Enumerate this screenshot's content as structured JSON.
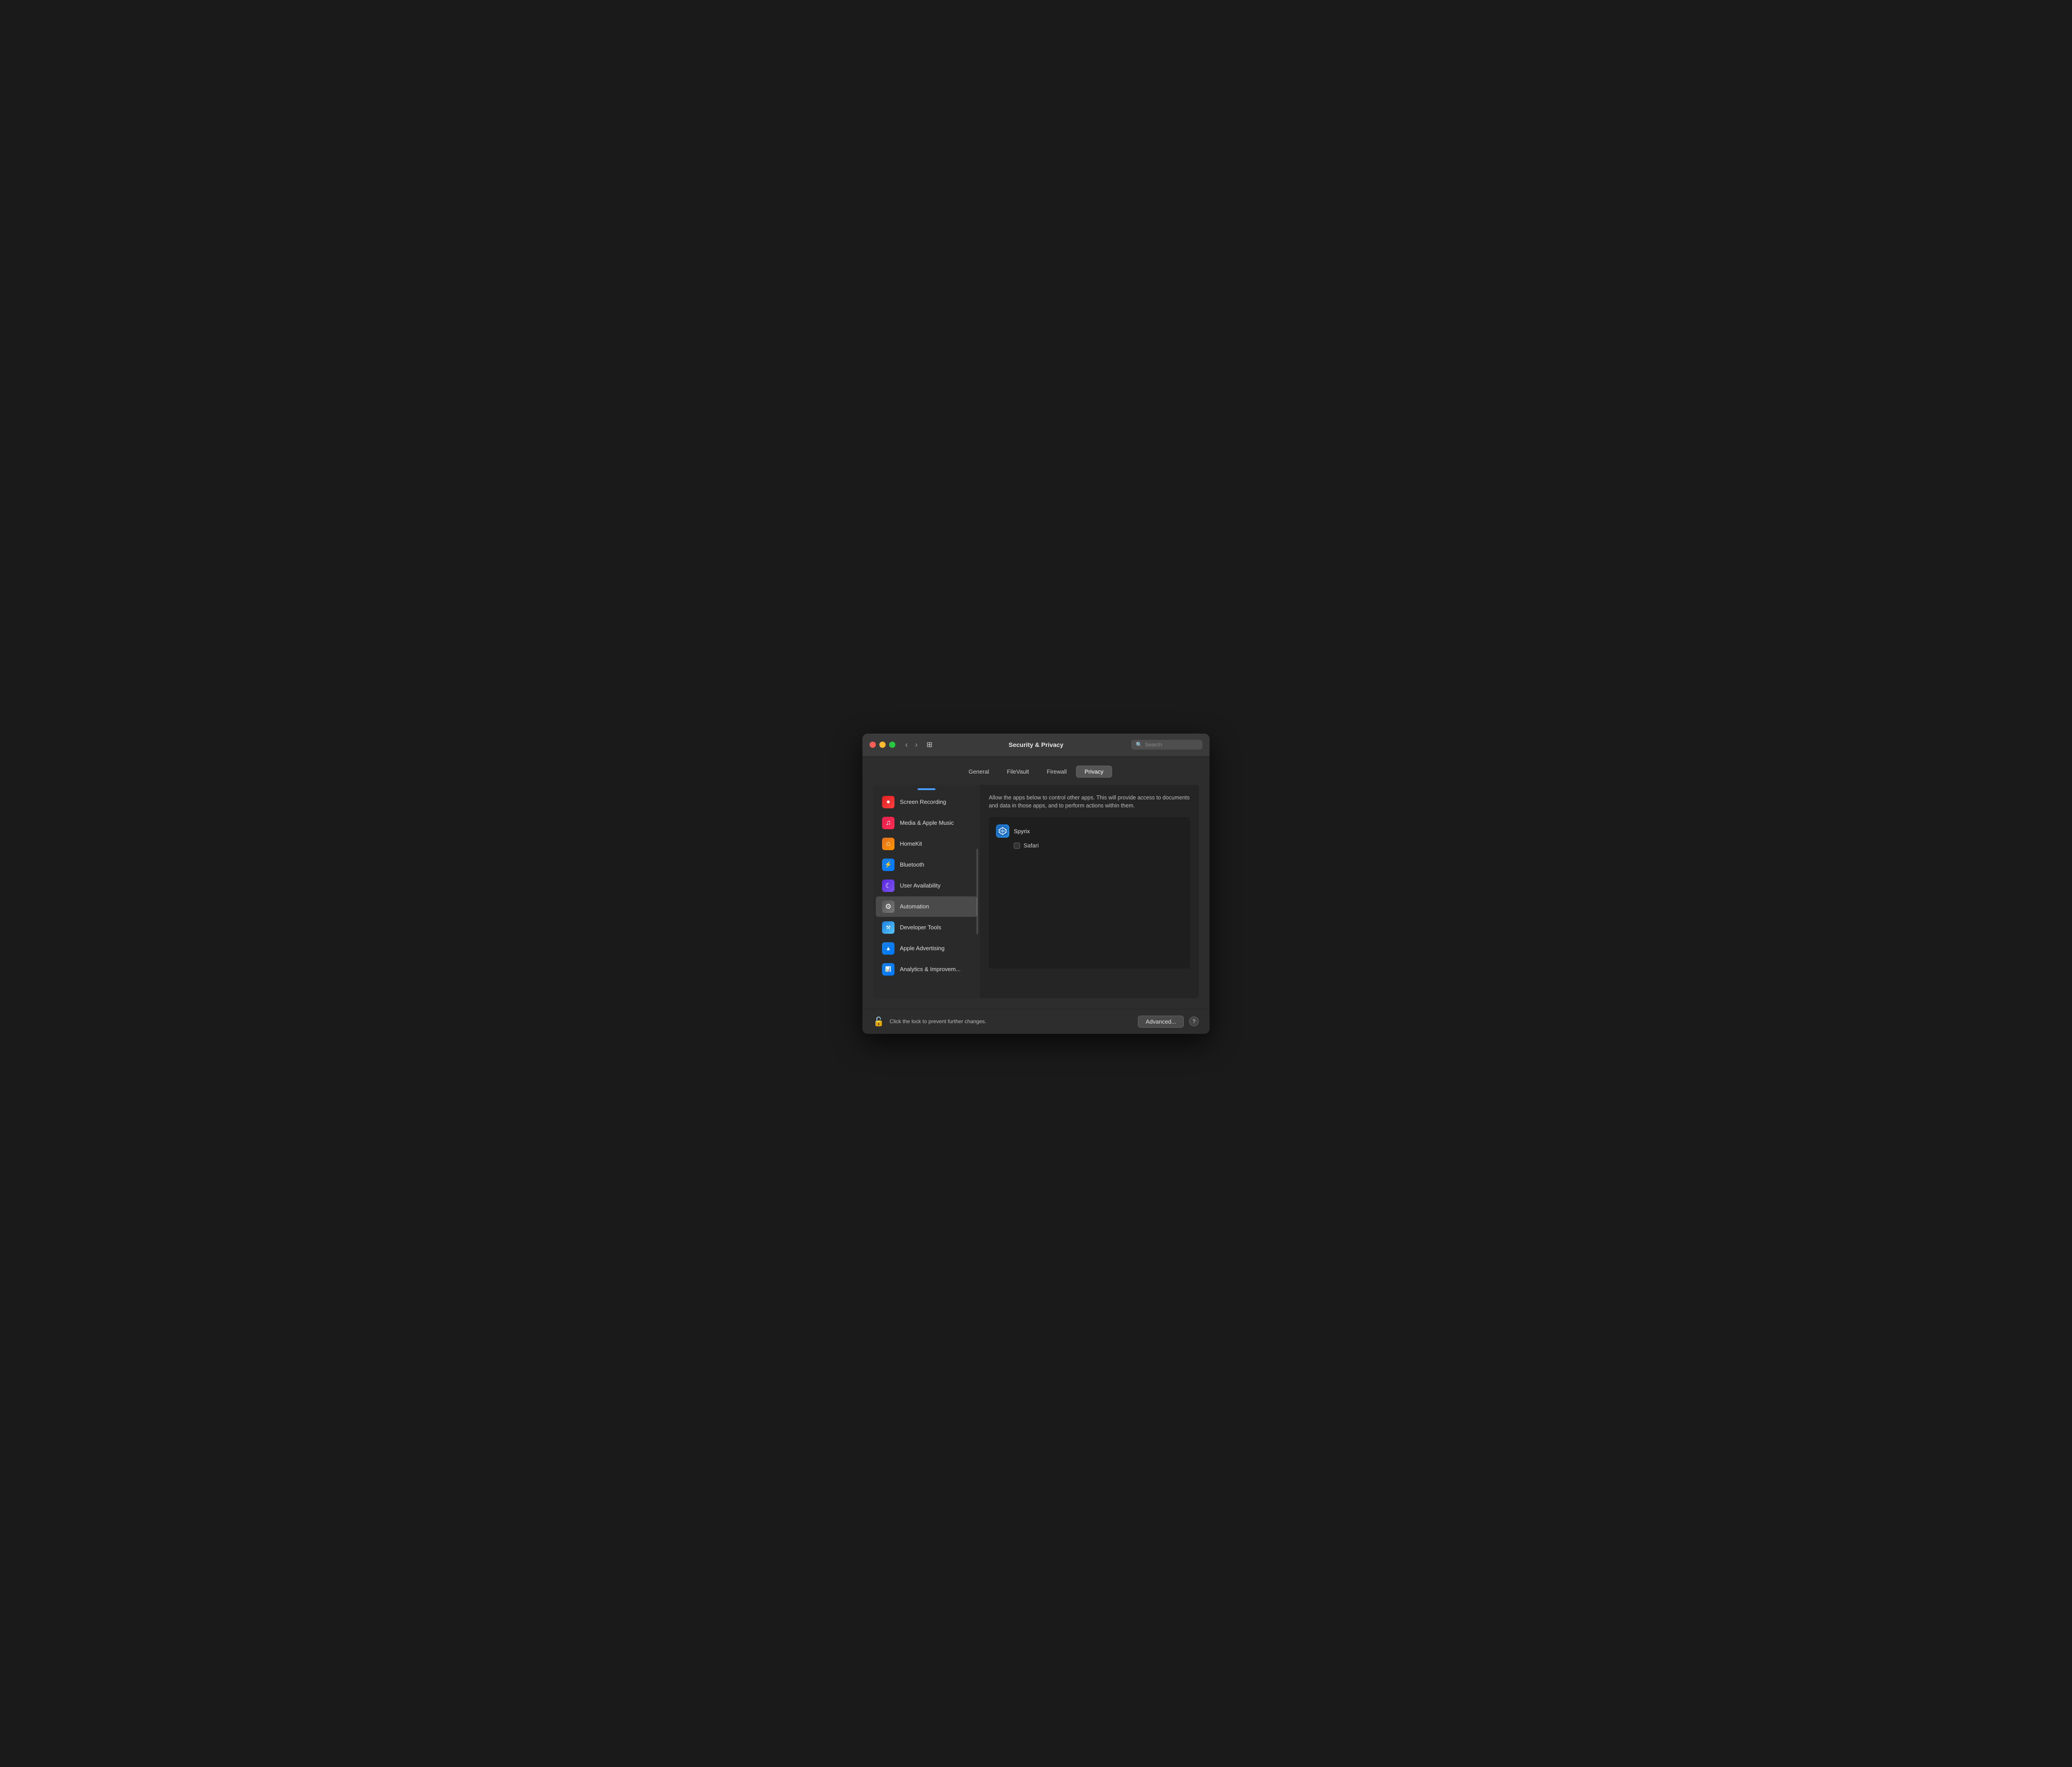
{
  "titlebar": {
    "title": "Security & Privacy",
    "search_placeholder": "Search"
  },
  "tabs": [
    {
      "label": "General",
      "active": false
    },
    {
      "label": "FileVault",
      "active": false
    },
    {
      "label": "Firewall",
      "active": false
    },
    {
      "label": "Privacy",
      "active": true
    }
  ],
  "sidebar": {
    "items": [
      {
        "id": "screen-recording",
        "label": "Screen Recording",
        "icon": "⏺",
        "iconClass": "icon-screen-rec",
        "active": false
      },
      {
        "id": "media-apple-music",
        "label": "Media & Apple Music",
        "icon": "♪",
        "iconClass": "icon-media",
        "active": false
      },
      {
        "id": "homekit",
        "label": "HomeKit",
        "icon": "⌂",
        "iconClass": "icon-homekit",
        "active": false
      },
      {
        "id": "bluetooth",
        "label": "Bluetooth",
        "icon": "❄",
        "iconClass": "icon-bluetooth",
        "active": false
      },
      {
        "id": "user-availability",
        "label": "User Availability",
        "icon": "☾",
        "iconClass": "icon-user-avail",
        "active": false
      },
      {
        "id": "automation",
        "label": "Automation",
        "icon": "⚙",
        "iconClass": "icon-automation",
        "active": true
      },
      {
        "id": "developer-tools",
        "label": "Developer Tools",
        "icon": "⚒",
        "iconClass": "icon-dev-tools",
        "active": false
      },
      {
        "id": "apple-advertising",
        "label": "Apple Advertising",
        "icon": "▲",
        "iconClass": "icon-apple-adv",
        "active": false
      },
      {
        "id": "analytics",
        "label": "Analytics & Improvem...",
        "icon": "▦",
        "iconClass": "icon-analytics",
        "active": false
      }
    ]
  },
  "right_panel": {
    "description": "Allow the apps below to control other apps. This will provide access to documents and data in those apps, and to perform actions within them.",
    "apps": [
      {
        "name": "Spyrix",
        "icon": "S",
        "iconClass": "spyrix-icon",
        "children": [
          {
            "name": "Safari",
            "checked": false
          }
        ]
      }
    ]
  },
  "bottom": {
    "lock_text": "Click the lock to prevent further changes.",
    "advanced_label": "Advanced...",
    "help_label": "?"
  }
}
